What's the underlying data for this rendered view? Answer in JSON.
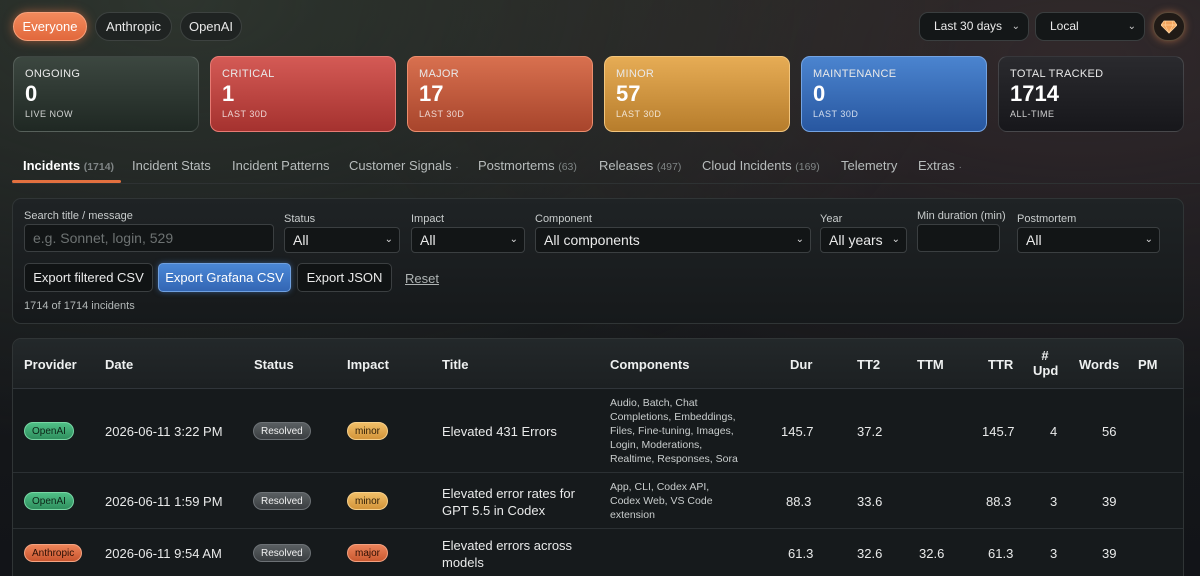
{
  "filters_top": {
    "pills": [
      "Everyone",
      "Anthropic",
      "OpenAI"
    ],
    "active_pill": "Everyone",
    "range": "Last 30 days",
    "timezone": "Local",
    "theme_icon": "gem-icon"
  },
  "cards": [
    {
      "label": "ONGOING",
      "value": "0",
      "sub": "LIVE NOW"
    },
    {
      "label": "CRITICAL",
      "value": "1",
      "sub": "LAST 30D"
    },
    {
      "label": "MAJOR",
      "value": "17",
      "sub": "LAST 30D"
    },
    {
      "label": "MINOR",
      "value": "57",
      "sub": "LAST 30D"
    },
    {
      "label": "MAINTENANCE",
      "value": "0",
      "sub": "LAST 30D"
    },
    {
      "label": "TOTAL TRACKED",
      "value": "1714",
      "sub": "ALL-TIME"
    }
  ],
  "tabs": [
    {
      "label": "Incidents",
      "count": "(1714)"
    },
    {
      "label": "Incident Stats",
      "count": ""
    },
    {
      "label": "Incident Patterns",
      "count": ""
    },
    {
      "label": "Customer Signals",
      "count": "·"
    },
    {
      "label": "Postmortems",
      "count": "(63)"
    },
    {
      "label": "Releases",
      "count": "(497)"
    },
    {
      "label": "Cloud Incidents",
      "count": "(169)"
    },
    {
      "label": "Telemetry",
      "count": ""
    },
    {
      "label": "Extras",
      "count": "·"
    }
  ],
  "panel": {
    "search_label": "Search title / message",
    "search_placeholder": "e.g. Sonnet, login, 529",
    "status_label": "Status",
    "status_value": "All",
    "impact_label": "Impact",
    "impact_value": "All",
    "component_label": "Component",
    "component_value": "All components",
    "year_label": "Year",
    "year_value": "All years",
    "duration_label": "Min duration (min)",
    "postmortem_label": "Postmortem",
    "postmortem_value": "All",
    "export_csv": "Export filtered CSV",
    "export_grafana": "Export Grafana CSV",
    "export_json": "Export JSON",
    "reset": "Reset",
    "count_text": "1714 of 1714 incidents"
  },
  "table": {
    "headers": {
      "provider": "Provider",
      "date": "Date",
      "status": "Status",
      "impact": "Impact",
      "title": "Title",
      "components": "Components",
      "dur": "Dur",
      "tt2": "TT2",
      "ttm": "TTM",
      "ttr": "TTR",
      "upd_1": "#",
      "upd_2": "Upd",
      "words": "Words",
      "pm": "PM"
    },
    "rows": [
      {
        "provider": "OpenAI",
        "date": "2026-06-11 3:22 PM",
        "status": "Resolved",
        "impact": "minor",
        "title_1": "Elevated 431 Errors",
        "title_2": "",
        "components": [
          "Audio, Batch, Chat",
          "Completions, Embeddings,",
          "Files, Fine-tuning, Images,",
          "Login, Moderations,",
          "Realtime, Responses, Sora"
        ],
        "dur": "145.7",
        "tt2": "37.2",
        "ttm": "",
        "ttr": "145.7",
        "upd": "4",
        "words": "56"
      },
      {
        "provider": "OpenAI",
        "date": "2026-06-11 1:59 PM",
        "status": "Resolved",
        "impact": "minor",
        "title_1": "Elevated error rates for",
        "title_2": "GPT 5.5 in Codex",
        "components": [
          "App, CLI, Codex API,",
          "Codex Web, VS Code",
          "extension"
        ],
        "dur": "88.3",
        "tt2": "33.6",
        "ttm": "",
        "ttr": "88.3",
        "upd": "3",
        "words": "39"
      },
      {
        "provider": "Anthropic",
        "date": "2026-06-11 9:54 AM",
        "status": "Resolved",
        "impact": "major",
        "title_1": "Elevated errors across",
        "title_2": "models",
        "components": [],
        "dur": "61.3",
        "tt2": "32.6",
        "ttm": "32.6",
        "ttr": "61.3",
        "upd": "3",
        "words": "39"
      }
    ]
  }
}
